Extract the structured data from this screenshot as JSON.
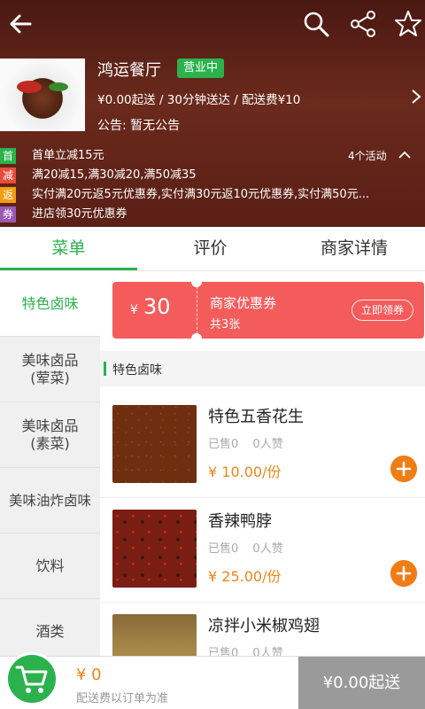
{
  "shop": {
    "name": "鸿运餐厅",
    "status_badge": "营业中",
    "delivery_info": "¥0.00起送 / 30分钟送达 / 配送费¥10",
    "notice": "公告: 暂无公告"
  },
  "promotions": [
    {
      "tag": "首",
      "color": "#2bb24c",
      "text": "首单立减15元"
    },
    {
      "tag": "减",
      "color": "#e84c3d",
      "text": "满20减15,满30减20,满50减35"
    },
    {
      "tag": "返",
      "color": "#f39c12",
      "text": "实付满20元返5元优惠券,实付满30元返10元优惠券,实付满50元..."
    },
    {
      "tag": "券",
      "color": "#9b59b6",
      "text": "进店领30元优惠券"
    }
  ],
  "activities_label": "4个活动",
  "tabs": [
    {
      "label": "菜单",
      "active": true
    },
    {
      "label": "评价",
      "active": false
    },
    {
      "label": "商家详情",
      "active": false
    }
  ],
  "sidebar": {
    "items": [
      {
        "label": "特色卤味",
        "active": true
      },
      {
        "label": "美味卤品\n(荤菜)",
        "active": false
      },
      {
        "label": "美味卤品\n(素菜)",
        "active": false
      },
      {
        "label": "美味油炸卤味",
        "active": false
      },
      {
        "label": "饮料",
        "active": false
      },
      {
        "label": "酒类",
        "active": false
      }
    ]
  },
  "coupon": {
    "currency": "¥",
    "amount": "30",
    "title": "商家优惠券",
    "count": "共3张",
    "claim_label": "立即领券"
  },
  "section_title": "特色卤味",
  "dishes": [
    {
      "name": "特色五香花生",
      "sold": "已售0",
      "likes": "0人赞",
      "price": "¥ 10.00/份",
      "icon": "peanut-image"
    },
    {
      "name": "香辣鸭脖",
      "sold": "已售0",
      "likes": "0人赞",
      "price": "¥ 25.00/份",
      "icon": "duck-neck-image"
    },
    {
      "name": "凉拌小米椒鸡翅",
      "sold": "已售0",
      "likes": "0人赞",
      "price": "",
      "icon": "chicken-wing-image"
    }
  ],
  "cart": {
    "total": "¥ 0",
    "note": "配送费以订单为准",
    "checkout_label": "¥0.00起送"
  },
  "colors": {
    "accent": "#2bb24c",
    "price": "#f08519",
    "coupon": "#f45c5c",
    "header": "#5b1f16"
  }
}
